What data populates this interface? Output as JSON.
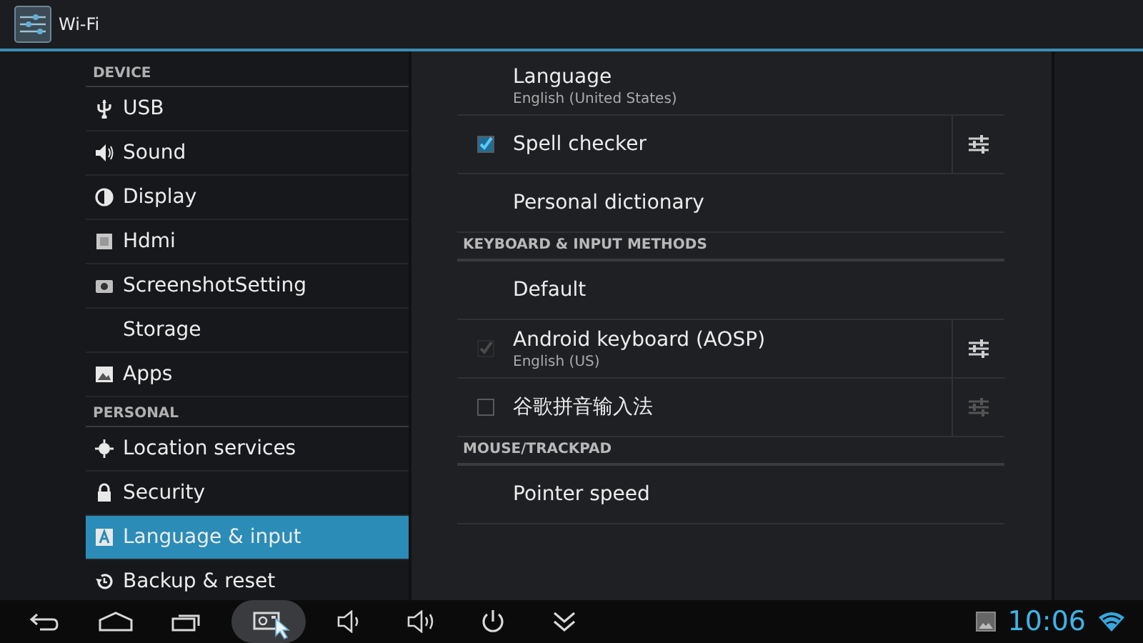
{
  "app_bar": {
    "title": "Wi-Fi"
  },
  "sidebar": {
    "sections": [
      {
        "header": "DEVICE",
        "items": [
          {
            "label": "USB",
            "kind": "usb",
            "selected": false
          },
          {
            "label": "Sound",
            "kind": "sound",
            "selected": false
          },
          {
            "label": "Display",
            "kind": "display",
            "selected": false
          },
          {
            "label": "Hdmi",
            "kind": "hdmi",
            "selected": false
          },
          {
            "label": "ScreenshotSetting",
            "kind": "screenshot",
            "selected": false
          },
          {
            "label": "Storage",
            "kind": "storage",
            "selected": false
          },
          {
            "label": "Apps",
            "kind": "apps",
            "selected": false
          }
        ]
      },
      {
        "header": "PERSONAL",
        "items": [
          {
            "label": "Location services",
            "kind": "location",
            "selected": false
          },
          {
            "label": "Security",
            "kind": "security",
            "selected": false
          },
          {
            "label": "Language & input",
            "kind": "language",
            "selected": true
          },
          {
            "label": "Backup & reset",
            "kind": "backup",
            "selected": false
          }
        ]
      }
    ]
  },
  "panel": {
    "groups": [
      {
        "items": [
          {
            "kind": "plain",
            "title": "Language",
            "summary": "English (United States)"
          },
          {
            "kind": "check",
            "title": "Spell checker",
            "checked": true,
            "checkbox_disabled": false,
            "settings_disabled": false
          },
          {
            "kind": "plain",
            "title": "Personal dictionary"
          }
        ]
      },
      {
        "header": "KEYBOARD & INPUT METHODS",
        "items": [
          {
            "kind": "plain",
            "title": "Default"
          },
          {
            "kind": "check",
            "title": "Android keyboard (AOSP)",
            "summary": "English (US)",
            "checked": true,
            "checkbox_disabled": true,
            "settings_disabled": false
          },
          {
            "kind": "check",
            "title": "谷歌拼音输入法",
            "checked": false,
            "checkbox_disabled": false,
            "settings_disabled": true
          }
        ]
      },
      {
        "header": "MOUSE/TRACKPAD",
        "items": [
          {
            "kind": "plain",
            "title": "Pointer speed"
          }
        ]
      }
    ]
  },
  "nav_bar": {
    "buttons": [
      {
        "kind": "back",
        "highlighted": false
      },
      {
        "kind": "home",
        "highlighted": false
      },
      {
        "kind": "recent",
        "highlighted": false
      },
      {
        "kind": "screenshot",
        "highlighted": true
      },
      {
        "kind": "volume_down",
        "highlighted": false
      },
      {
        "kind": "volume_up",
        "highlighted": false
      },
      {
        "kind": "power",
        "highlighted": false
      },
      {
        "kind": "more",
        "highlighted": false
      }
    ],
    "time": "10:06"
  }
}
